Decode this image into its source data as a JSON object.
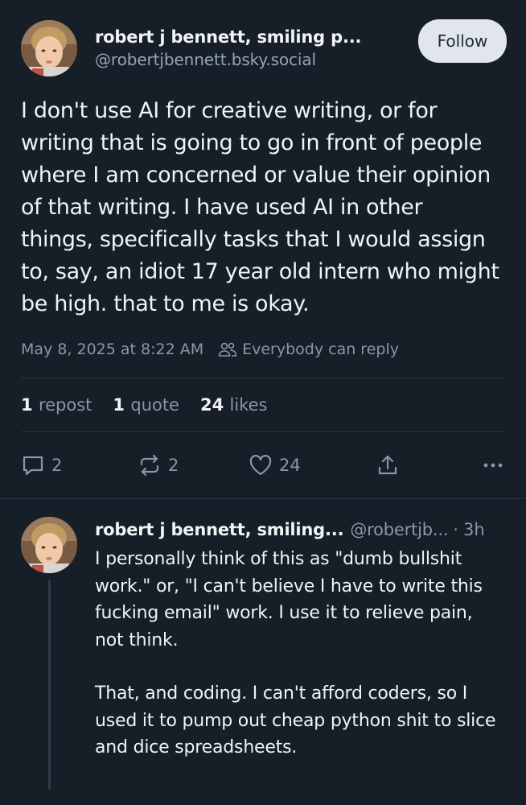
{
  "post": {
    "author": {
      "display_name": "robert j bennett, smiling p...",
      "handle": "@robertjbennett.bsky.social",
      "avatar_icon": "child-photo-avatar"
    },
    "follow_label": "Follow",
    "text": "I don't use AI for creative writing, or for writing that is going to go in front of people where I am concerned or value their opinion of that writing. I have used AI in other things, specifically tasks that I would assign to, say, an idiot 17 year old intern who might be high. that to me is okay.",
    "timestamp": "May 8, 2025 at 8:22 AM",
    "reply_setting": "Everybody can reply",
    "stats": {
      "reposts": {
        "count": "1",
        "label": "repost"
      },
      "quotes": {
        "count": "1",
        "label": "quote"
      },
      "likes": {
        "count": "24",
        "label": "likes"
      }
    },
    "actions": {
      "reply_count": "2",
      "repost_count": "2",
      "like_count": "24"
    }
  },
  "reply": {
    "author": {
      "display_name": "robert j bennett, smiling...",
      "handle": "@robertjb...",
      "separator": "·",
      "time": "3h"
    },
    "paragraphs": [
      "I personally think of this as \"dumb bullshit work.\" or, \"I can't believe I have to write this fucking email\" work. I use it to relieve pain, not think.",
      "That, and coding. I can't afford coders, so I used it to pump out cheap python shit to slice and dice spreadsheets."
    ]
  },
  "colors": {
    "background": "#161e27",
    "text_primary": "#f1f3f5",
    "text_secondary": "#8797aa",
    "divider": "#2c3845",
    "follow_button_bg": "#e0e6ec"
  }
}
